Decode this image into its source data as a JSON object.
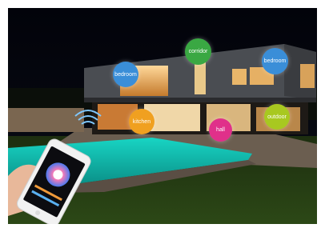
{
  "scene": {
    "description_icons": [
      "house",
      "pool",
      "smartphone",
      "hand",
      "wifi-icon",
      "color-wheel-icon"
    ]
  },
  "rooms": {
    "bedroom_left": {
      "label": "bedroom",
      "color": "#3a8ed8"
    },
    "corridor": {
      "label": "corridor",
      "color": "#3aa843"
    },
    "bedroom_right": {
      "label": "bedroom",
      "color": "#3a8ed8"
    },
    "kitchen": {
      "label": "kitchen",
      "color": "#f0a020"
    },
    "hall": {
      "label": "hall",
      "color": "#e0308a"
    },
    "outdoor": {
      "label": "outdoor",
      "color": "#a8c820"
    }
  }
}
